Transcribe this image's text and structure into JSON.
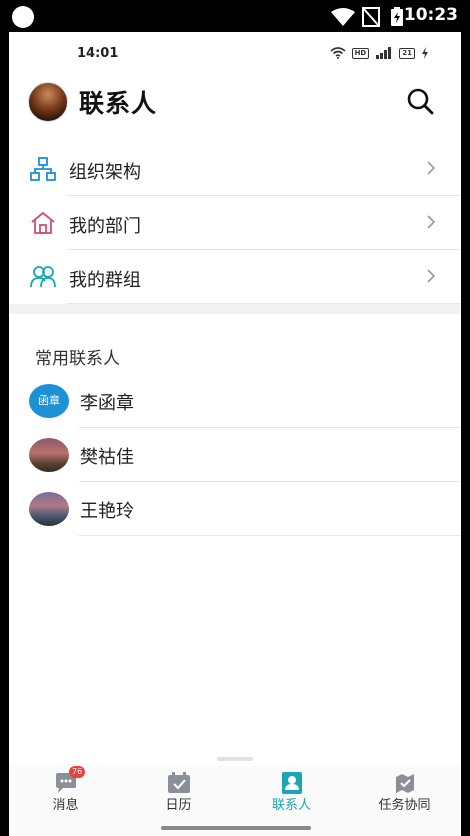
{
  "system_status": {
    "time": "10:23"
  },
  "inner_status": {
    "time": "14:01",
    "battery": "21"
  },
  "header": {
    "title": "联系人"
  },
  "menu": {
    "items": [
      {
        "label": "组织架构",
        "icon": "org-chart-icon"
      },
      {
        "label": "我的部门",
        "icon": "home-icon"
      },
      {
        "label": "我的群组",
        "icon": "group-icon"
      }
    ]
  },
  "frequent": {
    "title": "常用联系人",
    "contacts": [
      {
        "name": "李函章",
        "avatar_text": "函章"
      },
      {
        "name": "樊祜佳"
      },
      {
        "name": "王艳玲"
      }
    ]
  },
  "tabs": [
    {
      "label": "消息",
      "badge": "76",
      "icon": "message-icon"
    },
    {
      "label": "日历",
      "icon": "calendar-icon"
    },
    {
      "label": "联系人",
      "icon": "contacts-icon",
      "active": true
    },
    {
      "label": "任务协同",
      "icon": "task-icon"
    }
  ],
  "colors": {
    "accent": "#1aa6b4",
    "badge": "#e94040",
    "org_icon": "#1e90d6",
    "home_icon": "#d0506e",
    "group_icon": "#1aa6b4"
  }
}
